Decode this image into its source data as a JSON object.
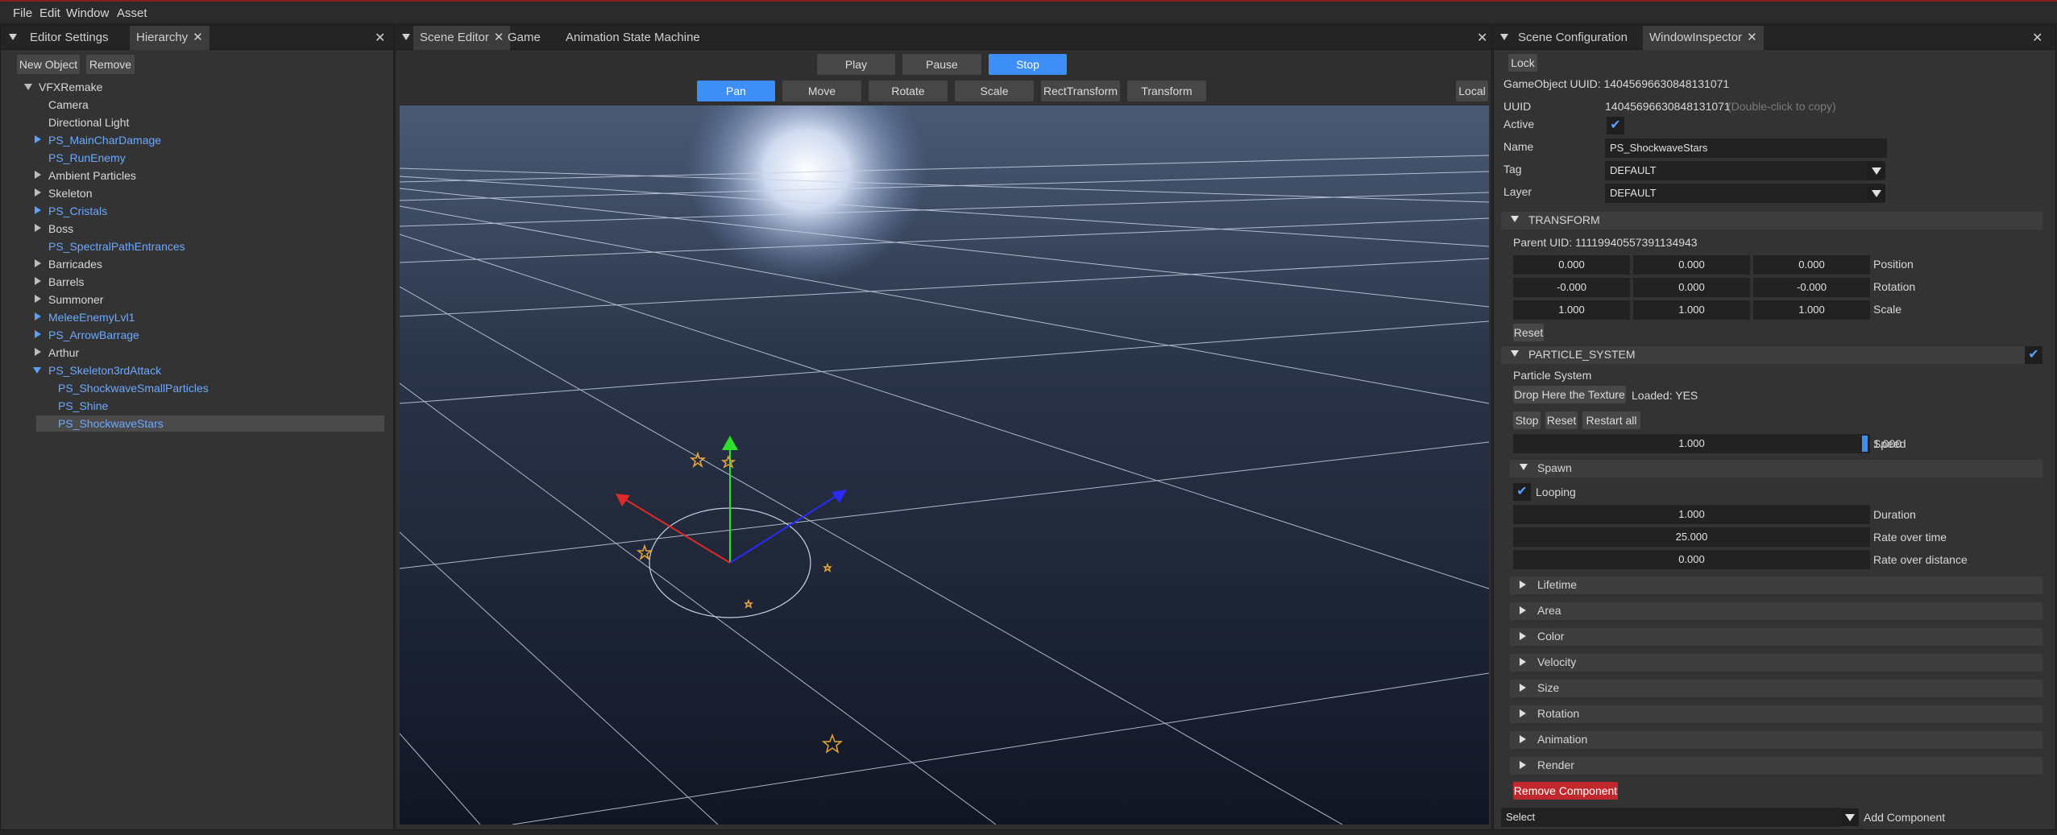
{
  "menubar": {
    "file": "File",
    "edit": "Edit",
    "window": "Window",
    "asset": "Asset"
  },
  "left": {
    "tabs": [
      "Editor Settings",
      "Hierarchy"
    ],
    "new_object": "New Object",
    "remove": "Remove",
    "tree": {
      "root": "VFXRemake",
      "items": [
        "Camera",
        "Directional Light",
        "PS_MainCharDamage",
        "PS_RunEnemy",
        "Ambient Particles",
        "Skeleton",
        "PS_Cristals",
        "Boss",
        "PS_SpectralPathEntrances",
        "Barricades",
        "Barrels",
        "Summoner",
        "MeleeEnemyLvl1",
        "PS_ArrowBarrage",
        "Arthur",
        "PS_Skeleton3rdAttack",
        "PS_ShockwaveSmallParticles",
        "PS_Shine",
        "PS_ShockwaveStars"
      ]
    }
  },
  "center": {
    "tabs": [
      "Scene Editor",
      "Game",
      "Animation State Machine"
    ],
    "play": "Play",
    "pause": "Pause",
    "stop": "Stop",
    "tools": [
      "Pan",
      "Move",
      "Rotate",
      "Scale",
      "RectTransform",
      "Transform"
    ],
    "local": "Local"
  },
  "right": {
    "tabs": [
      "Scene Configuration",
      "WindowInspector"
    ],
    "lock": "Lock",
    "go_uuid": "GameObject UUID: 14045696630848131071",
    "uuid_label": "UUID",
    "uuid_value": "14045696630848131071",
    "uuid_hint": "(Double-click to copy)",
    "active_label": "Active",
    "name_label": "Name",
    "name_value": "PS_ShockwaveStars",
    "tag_label": "Tag",
    "tag_value": "DEFAULT",
    "layer_label": "Layer",
    "layer_value": "DEFAULT",
    "transform": {
      "header": "TRANSFORM",
      "parent": "Parent UID: 11119940557391134943",
      "position": [
        "0.000",
        "0.000",
        "0.000"
      ],
      "position_label": "Position",
      "rotation": [
        "-0.000",
        "0.000",
        "-0.000"
      ],
      "rotation_label": "Rotation",
      "scale": [
        "1.000",
        "1.000",
        "1.000"
      ],
      "scale_label": "Scale",
      "reset": "Reset"
    },
    "particle": {
      "header": "PARTICLE_SYSTEM",
      "title": "Particle System",
      "drop_texture": "Drop Here the Texture",
      "loaded": "Loaded: YES",
      "stop": "Stop",
      "reset": "Reset",
      "restart": "Restart all",
      "speed_value": "1.000",
      "speed_label": "Speed",
      "spawn": "Spawn",
      "looping": "Looping",
      "duration_value": "1.000",
      "duration_label": "Duration",
      "rot_value": "25.000",
      "rot_label": "Rate over time",
      "rod_value": "0.000",
      "rod_label": "Rate over distance",
      "modules": [
        "Lifetime",
        "Area",
        "Color",
        "Velocity",
        "Size",
        "Rotation",
        "Animation",
        "Render"
      ]
    },
    "remove_component": "Remove Component",
    "select": "Select",
    "add_component": "Add Component"
  }
}
